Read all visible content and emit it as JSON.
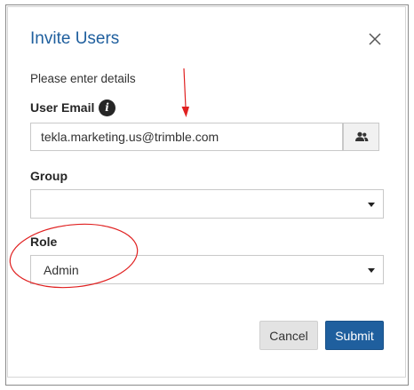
{
  "dialog": {
    "title": "Invite Users",
    "subtitle": "Please enter details",
    "close_icon": "close-icon"
  },
  "fields": {
    "email": {
      "label": "User Email",
      "info_icon": "info-icon",
      "info_glyph": "i",
      "value": "tekla.marketing.us@trimble.com",
      "lookup_icon": "people-icon"
    },
    "group": {
      "label": "Group",
      "value": ""
    },
    "role": {
      "label": "Role",
      "value": "Admin"
    }
  },
  "buttons": {
    "cancel": "Cancel",
    "submit": "Submit"
  },
  "colors": {
    "accent": "#1f5f9e",
    "annotation": "#e02020"
  }
}
